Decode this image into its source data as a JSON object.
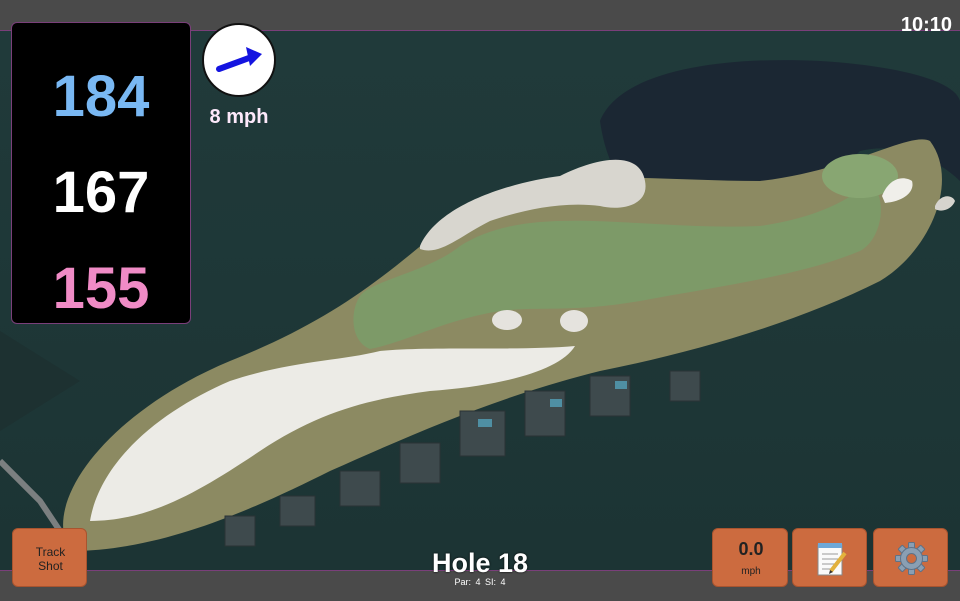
{
  "status": {
    "time": "10:10"
  },
  "distances": {
    "back": "184",
    "middle": "167",
    "front": "155"
  },
  "wind": {
    "speed_label": "8 mph",
    "icon": "wind-direction-arrow-icon",
    "direction": "east-northeast"
  },
  "buttons": {
    "track_shot": "Track\nShot",
    "wind_value": "0.0",
    "wind_unit": "mph",
    "notes_icon": "notepad-icon",
    "settings_icon": "gear-icon"
  },
  "hole": {
    "title": "Hole 18",
    "par_label": "Par: 4",
    "si_label": "SI: 4"
  },
  "colors": {
    "back": "#79b8f3",
    "middle": "#ffffff",
    "front": "#f08bc6",
    "button": "#cc6b3f",
    "accent_border": "#7a3f7a"
  }
}
